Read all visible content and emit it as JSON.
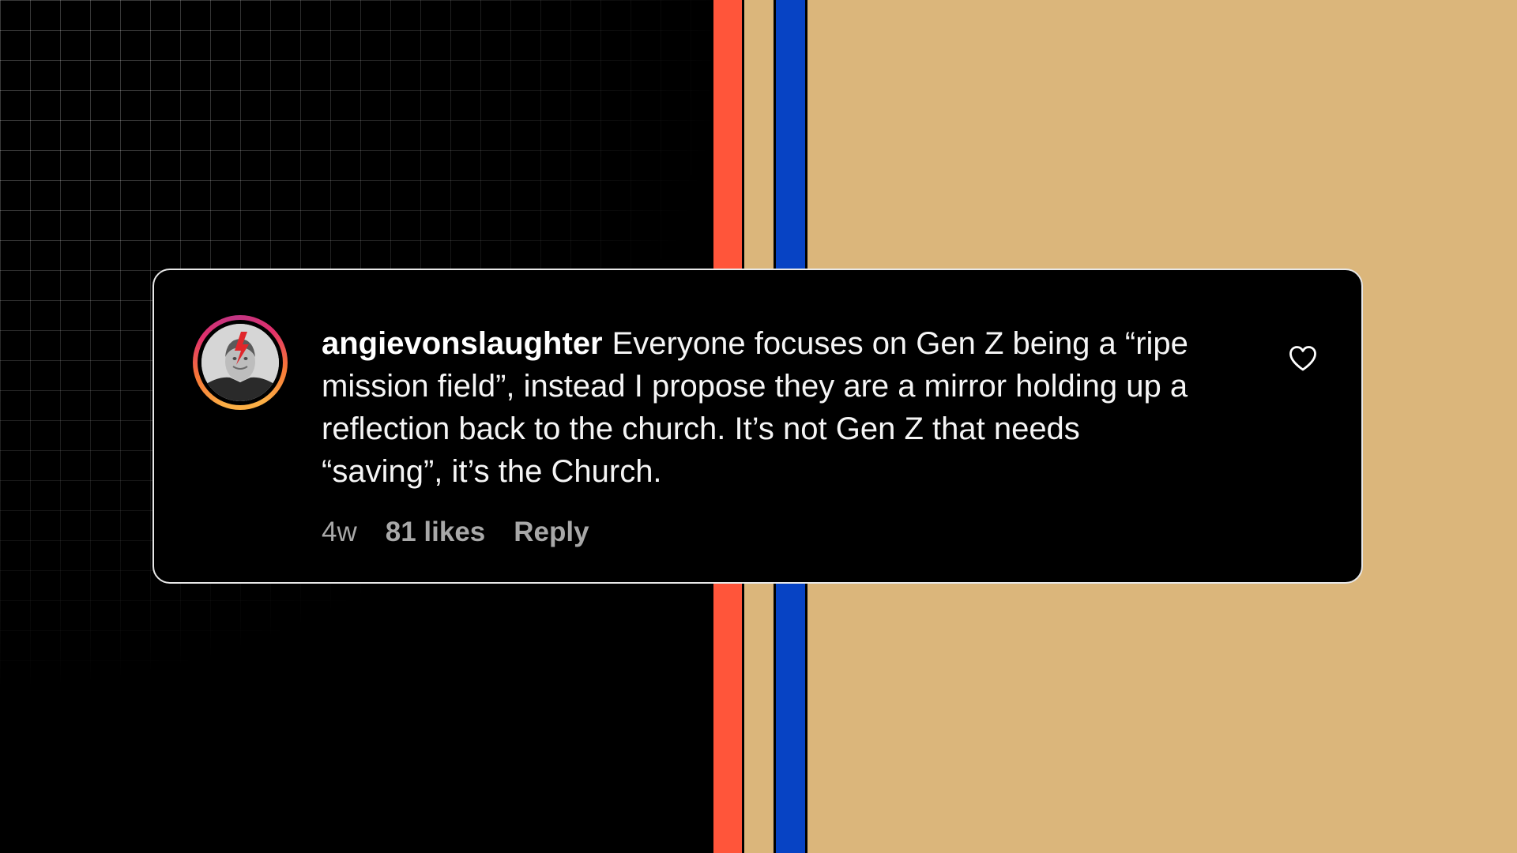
{
  "colors": {
    "orange_stripe": "#ff553a",
    "tan": "#dbb67b",
    "blue_stripe": "#0743c4",
    "card_border": "#e8e8e8",
    "meta_text": "#a8a8a8"
  },
  "comment": {
    "username": "angievonslaughter",
    "text": "Everyone focuses on Gen Z being a “ripe mission field”, instead I propose they are a mirror holding up a reflection back to the church. It’s not Gen Z that needs “saving”, it’s the Church.",
    "age": "4w",
    "likes": "81 likes",
    "reply_label": "Reply",
    "avatar_icon": "user-avatar-icon",
    "like_icon": "heart-outline-icon"
  }
}
